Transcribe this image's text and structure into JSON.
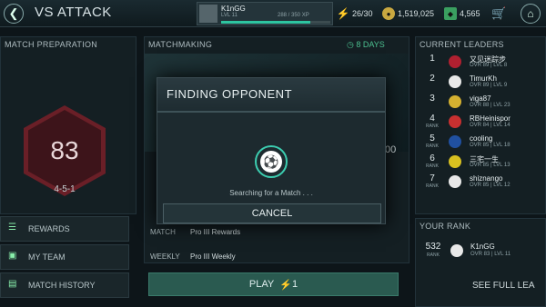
{
  "header": {
    "title": "VS ATTACK",
    "player_name": "K1nGG",
    "player_level": "LVL 11",
    "xp": "288 / 350 XP",
    "xp_progress": 0.82,
    "stamina": "26/30",
    "coins": "1,519,025",
    "points": "4,565"
  },
  "match_prep": {
    "heading": "MATCH PREPARATION",
    "rating": "83",
    "formation": "4-5-1"
  },
  "left_menu": [
    {
      "label": "REWARDS",
      "icon": "rewards-icon"
    },
    {
      "label": "MY TEAM",
      "icon": "jersey-icon"
    },
    {
      "label": "MATCH HISTORY",
      "icon": "history-icon"
    }
  ],
  "matchmaking": {
    "heading": "MATCHMAKING",
    "days": "8 DAYS",
    "number_partial": "00",
    "row1_label": "MATCH",
    "row1_value": "Pro III Rewards",
    "row2_label": "WEEKLY",
    "row2_value": "Pro III Weekly",
    "play_label": "PLAY",
    "play_cost": "1"
  },
  "leaders": {
    "heading": "CURRENT LEADERS",
    "rows": [
      {
        "rank": "1",
        "sub": "",
        "name": "又见迷踪步",
        "ovr": "OVR 89 | LVL 8",
        "color": "#b02030"
      },
      {
        "rank": "2",
        "sub": "",
        "name": "TimurKh",
        "ovr": "OVR 89 | LVL 9",
        "color": "#e8e8e8"
      },
      {
        "rank": "3",
        "sub": "",
        "name": "viga87",
        "ovr": "OVR 88 | LVL 23",
        "color": "#d4b030"
      },
      {
        "rank": "4",
        "sub": "RANK",
        "name": "RBHeinispor",
        "ovr": "OVR 84 | LVL 14",
        "color": "#c83030"
      },
      {
        "rank": "5",
        "sub": "RANK",
        "name": "cooling",
        "ovr": "OVR 85 | LVL 18",
        "color": "#2050a0"
      },
      {
        "rank": "6",
        "sub": "RANK",
        "name": "三宅一生",
        "ovr": "OVR 85 | LVL 13",
        "color": "#d8c020"
      },
      {
        "rank": "7",
        "sub": "RANK",
        "name": "shiznango",
        "ovr": "OVR 85 | LVL 12",
        "color": "#e8e8e8"
      }
    ]
  },
  "your_rank": {
    "heading": "YOUR RANK",
    "rank": "532",
    "sub": "RANK",
    "name": "K1nGG",
    "ovr": "OVR 83 | LVL 11",
    "see_full": "SEE FULL LEA"
  },
  "modal": {
    "title": "FINDING OPPONENT",
    "searching": "Searching for a Match . . .",
    "cancel": "CANCEL"
  }
}
